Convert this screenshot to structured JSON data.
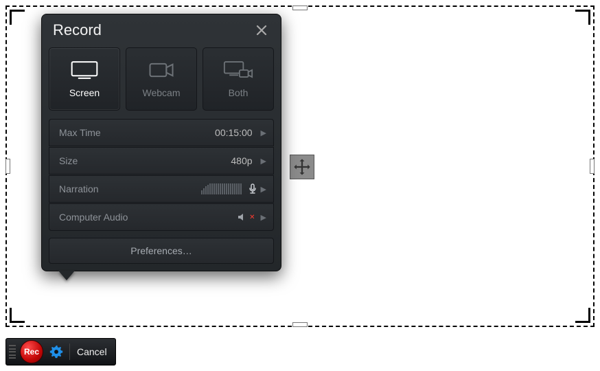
{
  "popup": {
    "title": "Record",
    "modes": [
      {
        "label": "Screen",
        "active": true
      },
      {
        "label": "Webcam",
        "active": false
      },
      {
        "label": "Both",
        "active": false
      }
    ],
    "settings": {
      "max_time": {
        "label": "Max Time",
        "value": "00:15:00"
      },
      "size": {
        "label": "Size",
        "value": "480p"
      },
      "narration": {
        "label": "Narration"
      },
      "computer_audio": {
        "label": "Computer Audio",
        "muted": true
      }
    },
    "preferences_label": "Preferences…"
  },
  "toolbar": {
    "rec_label": "Rec",
    "cancel_label": "Cancel"
  }
}
